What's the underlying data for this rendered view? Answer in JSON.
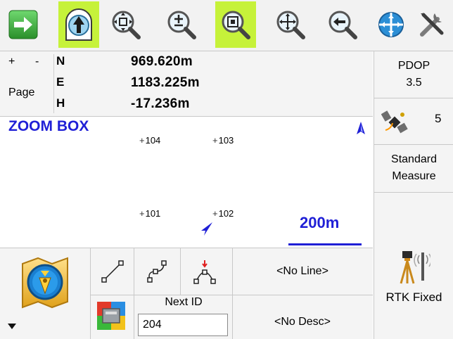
{
  "coords": {
    "plus_label": "+",
    "minus_label": "-",
    "page_label": "Page",
    "n_label": "N",
    "e_label": "E",
    "h_label": "H",
    "n_value": "969.620m",
    "e_value": "1183.225m",
    "h_value": "-17.236m"
  },
  "status": {
    "pdop_label": "PDOP",
    "pdop_value": "3.5",
    "satellites": "5",
    "mode_line1": "Standard",
    "mode_line2": "Measure",
    "rtk_status": "RTK Fixed"
  },
  "map": {
    "mode_label": "ZOOM BOX",
    "points": [
      {
        "id": "104"
      },
      {
        "id": "103"
      },
      {
        "id": "101"
      },
      {
        "id": "102"
      }
    ],
    "scale_label": "200m"
  },
  "bottom": {
    "line_name": "<No Line>",
    "desc_name": "<No Desc>",
    "next_id_label": "Next ID",
    "next_id_value": "204"
  },
  "colors": {
    "active_tool": "#c6f23a",
    "map_text": "#1f1fd6",
    "exit_green": "#3aa63a"
  },
  "icons": {
    "toolbar": [
      "exit-arrow-icon",
      "map-up-icon",
      "zoom-extents-icon",
      "zoom-in-out-icon",
      "zoom-box-icon",
      "pan-icon",
      "zoom-previous-icon",
      "globe-icon",
      "tools-icon"
    ]
  }
}
